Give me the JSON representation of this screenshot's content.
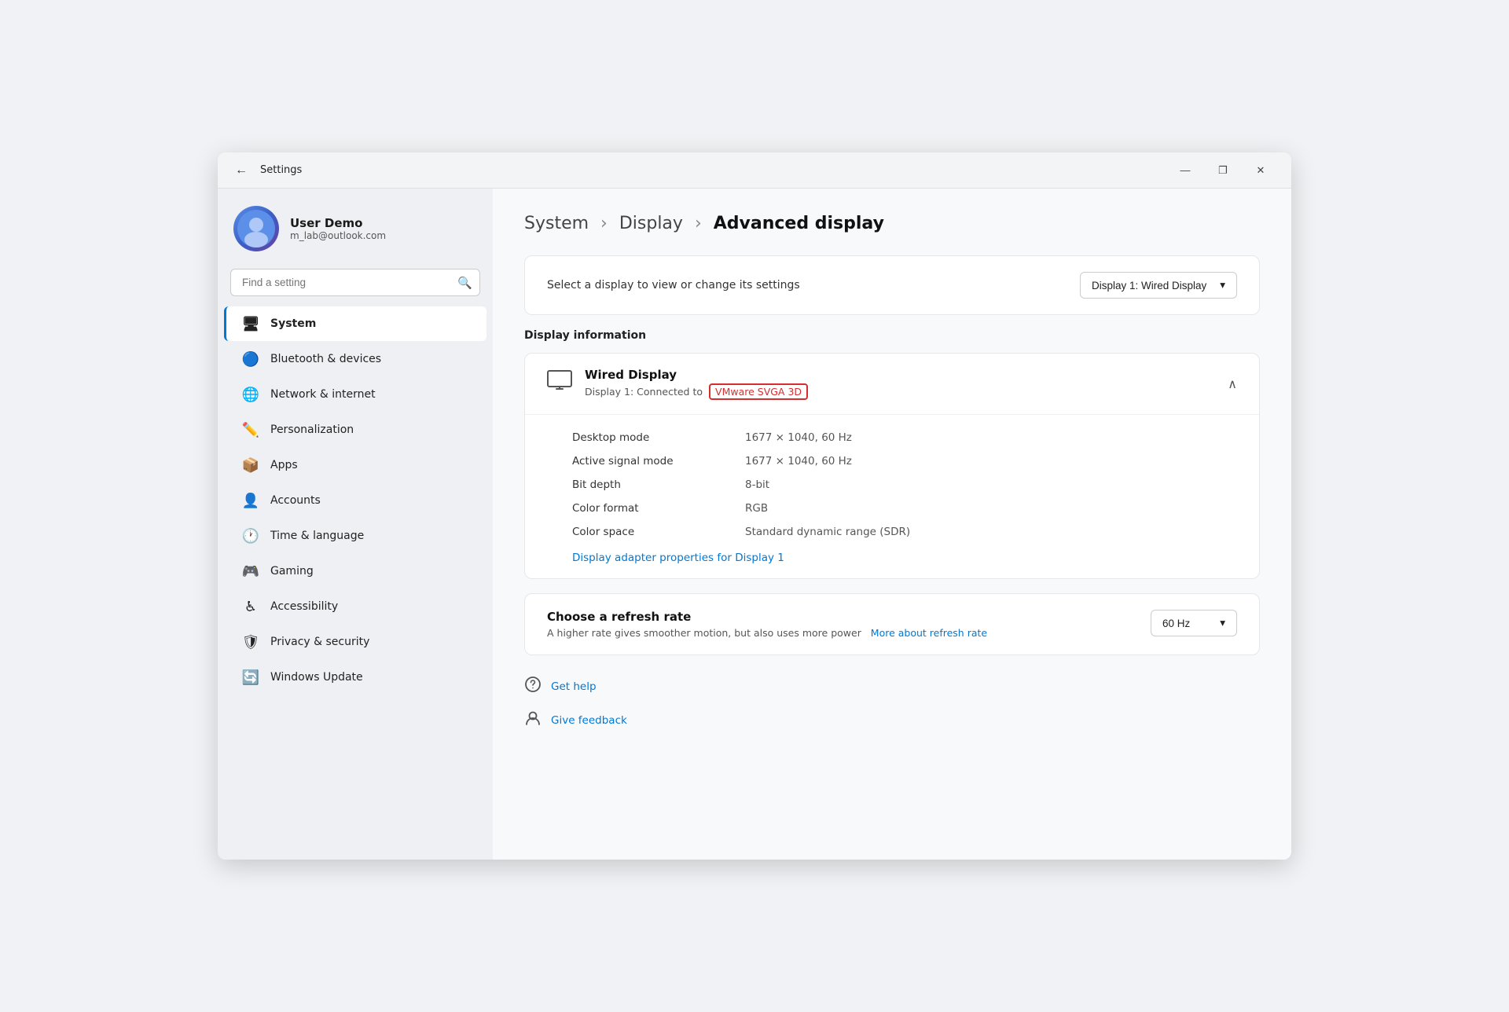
{
  "window": {
    "title": "Settings",
    "back_label": "←",
    "minimize_label": "—",
    "maximize_label": "❐",
    "close_label": "✕"
  },
  "sidebar": {
    "user": {
      "name": "User Demo",
      "email": "m_lab@outlook.com"
    },
    "search": {
      "placeholder": "Find a setting",
      "icon": "🔍"
    },
    "nav_items": [
      {
        "id": "system",
        "label": "System",
        "icon": "🖥",
        "active": true
      },
      {
        "id": "bluetooth",
        "label": "Bluetooth & devices",
        "icon": "🔵"
      },
      {
        "id": "network",
        "label": "Network & internet",
        "icon": "🌐"
      },
      {
        "id": "personalization",
        "label": "Personalization",
        "icon": "✏️"
      },
      {
        "id": "apps",
        "label": "Apps",
        "icon": "📦"
      },
      {
        "id": "accounts",
        "label": "Accounts",
        "icon": "👤"
      },
      {
        "id": "time",
        "label": "Time & language",
        "icon": "🕐"
      },
      {
        "id": "gaming",
        "label": "Gaming",
        "icon": "🎮"
      },
      {
        "id": "accessibility",
        "label": "Accessibility",
        "icon": "♿"
      },
      {
        "id": "privacy",
        "label": "Privacy & security",
        "icon": "🛡"
      },
      {
        "id": "windows-update",
        "label": "Windows Update",
        "icon": "🔄"
      }
    ]
  },
  "content": {
    "breadcrumb": {
      "part1": "System",
      "sep1": ">",
      "part2": "Display",
      "sep2": ">",
      "part3": "Advanced display"
    },
    "display_selector": {
      "label": "Select a display to view or change its settings",
      "value": "Display 1: Wired Display"
    },
    "display_info": {
      "section_title": "Display information",
      "name": "Wired Display",
      "subtitle_prefix": "Display 1: Connected to",
      "badge": "VMware SVGA 3D",
      "specs": [
        {
          "label": "Desktop mode",
          "value": "1677 × 1040, 60 Hz"
        },
        {
          "label": "Active signal mode",
          "value": "1677 × 1040, 60 Hz"
        },
        {
          "label": "Bit depth",
          "value": "8-bit"
        },
        {
          "label": "Color format",
          "value": "RGB"
        },
        {
          "label": "Color space",
          "value": "Standard dynamic range (SDR)"
        }
      ],
      "adapter_link": "Display adapter properties for Display 1"
    },
    "refresh_rate": {
      "title": "Choose a refresh rate",
      "desc": "A higher rate gives smoother motion, but also uses more power",
      "more_link_label": "More about refresh rate",
      "value": "60 Hz"
    },
    "help": {
      "get_help_label": "Get help",
      "give_feedback_label": "Give feedback"
    }
  }
}
